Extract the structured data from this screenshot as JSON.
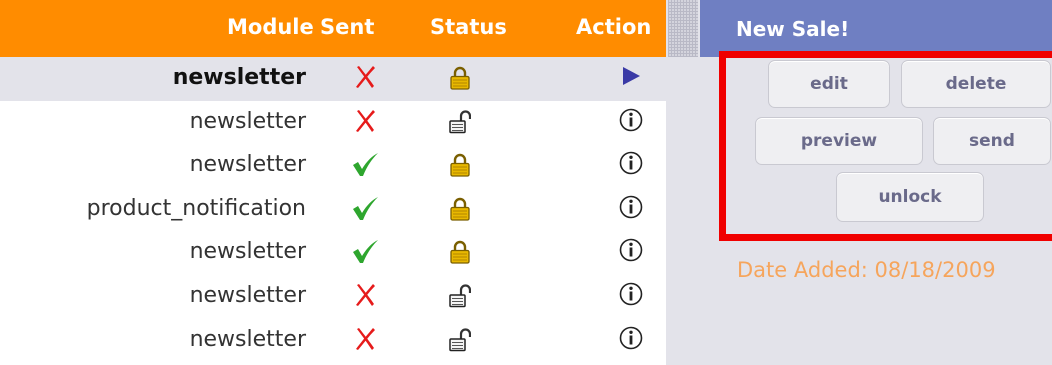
{
  "table": {
    "headers": {
      "module": "Module",
      "sent": "Sent",
      "status": "Status",
      "action": "Action"
    },
    "rows": [
      {
        "module": "newsletter",
        "sent": "cross",
        "status": "locked",
        "action": "play",
        "selected": true
      },
      {
        "module": "newsletter",
        "sent": "cross",
        "status": "unlocked",
        "action": "info",
        "selected": false
      },
      {
        "module": "newsletter",
        "sent": "check",
        "status": "locked",
        "action": "info",
        "selected": false
      },
      {
        "module": "product_notification",
        "sent": "check",
        "status": "locked",
        "action": "info",
        "selected": false
      },
      {
        "module": "newsletter",
        "sent": "check",
        "status": "locked",
        "action": "info",
        "selected": false
      },
      {
        "module": "newsletter",
        "sent": "cross",
        "status": "unlocked",
        "action": "info",
        "selected": false
      },
      {
        "module": "newsletter",
        "sent": "cross",
        "status": "unlocked",
        "action": "info",
        "selected": false
      }
    ]
  },
  "panel": {
    "title": "New Sale!",
    "buttons": {
      "edit": "edit",
      "delete": "delete",
      "preview": "preview",
      "send": "send",
      "unlock": "unlock"
    },
    "date_added": "Date Added: 08/18/2009"
  },
  "colors": {
    "header_orange": "#ff8c00",
    "panel_header": "#6f7fc2",
    "highlight_red": "#f00000",
    "date_text": "#f6a55c",
    "cross_red": "#e61b1b",
    "check_green": "#2ea62e",
    "lock_gold": "#e8b800",
    "play_blue": "#3a3aa6"
  }
}
